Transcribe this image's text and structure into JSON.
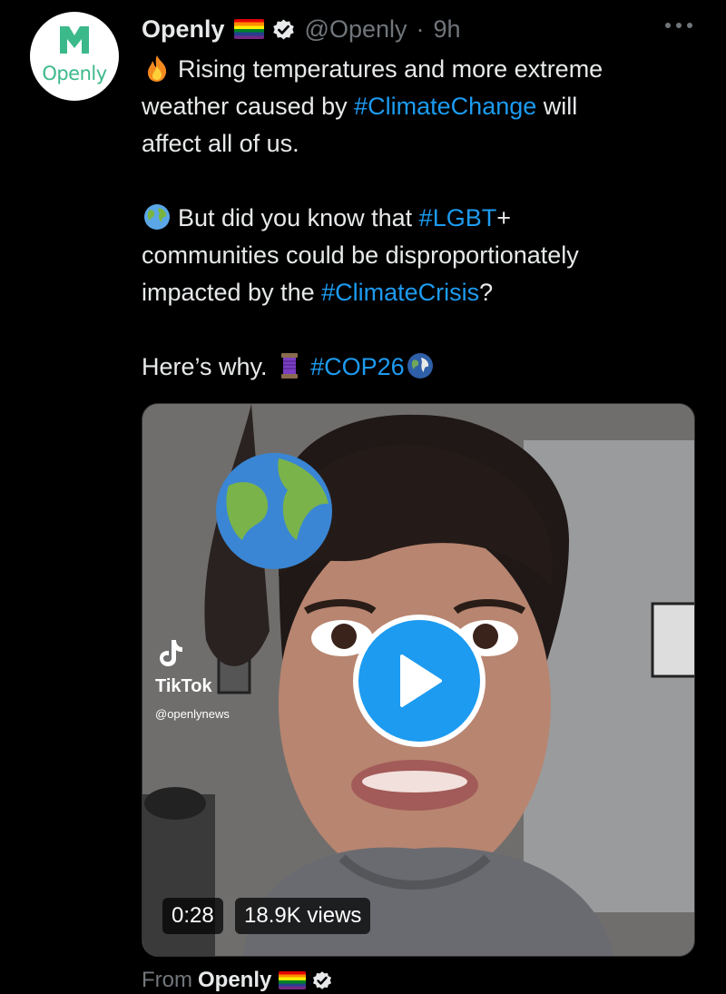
{
  "author": {
    "avatar_text": "Openly",
    "name": "Openly",
    "handle": "@Openly",
    "separator": "·",
    "time": "9h"
  },
  "tweet": {
    "line1_a": "Rising temperatures and more extreme",
    "line2_a": "weather caused by ",
    "line2_tag": "#ClimateChange",
    "line2_b": " will",
    "line3": "affect all of us.",
    "line4_a": "But did you know that ",
    "line4_tag": "#LGBT",
    "line4_b": "+",
    "line5": "communities could be disproportionately",
    "line6_a": "impacted by the ",
    "line6_tag": "#ClimateCrisis",
    "line6_b": "?",
    "line7_a": "Here’s why. ",
    "line7_tag": "#COP26"
  },
  "media": {
    "tiktok_label": "TikTok",
    "tiktok_user": "@openlynews",
    "duration": "0:28",
    "views": "18.9K views"
  },
  "footer": {
    "from_label": "From",
    "source_name": "Openly"
  },
  "colors": {
    "background": "#000000",
    "text": "#e7e9ea",
    "muted": "#71767b",
    "accent": "#1d9bf0",
    "brand": "#3cb98a"
  },
  "icons": [
    "fire-emoji",
    "globe-emoji",
    "thread-emoji",
    "earth-emoji",
    "verified-icon",
    "rainbow-flag-icon",
    "more-icon",
    "play-icon",
    "tiktok-icon"
  ]
}
